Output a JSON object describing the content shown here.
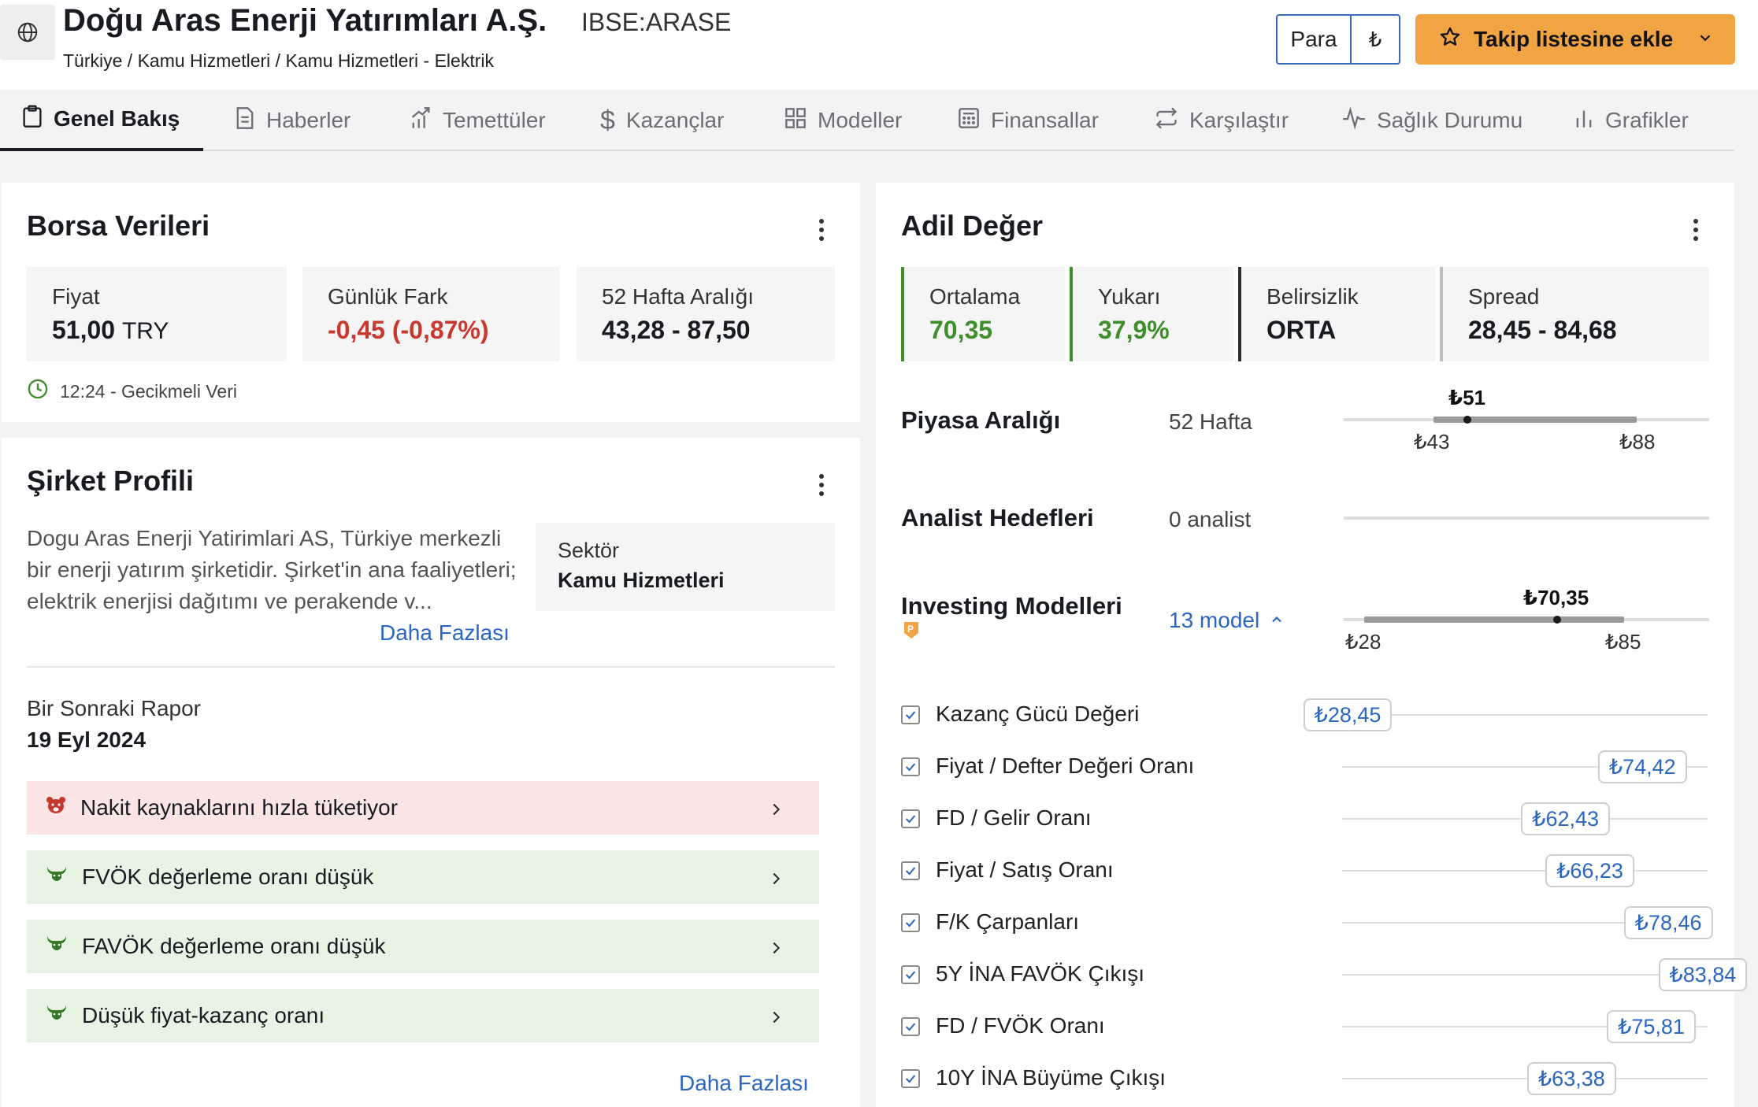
{
  "header": {
    "company_name": "Doğu Aras Enerji Yatırımları A.Ş.",
    "ticker": "IBSE:ARASE",
    "breadcrumb": "Türkiye / Kamu Hizmetleri / Kamu Hizmetleri - Elektrik",
    "currency_label": "Para",
    "currency_symbol": "₺",
    "watchlist_label": "Takip listesine ekle"
  },
  "tabs": [
    {
      "label": "Genel Bakış",
      "icon": "clipboard-icon",
      "active": true
    },
    {
      "label": "Haberler",
      "icon": "document-icon"
    },
    {
      "label": "Temettüler",
      "icon": "growth-chart-icon"
    },
    {
      "label": "Kazançlar",
      "icon": "dollar-icon"
    },
    {
      "label": "Modeller",
      "icon": "grid-icon"
    },
    {
      "label": "Finansallar",
      "icon": "calculator-icon"
    },
    {
      "label": "Karşılaştır",
      "icon": "compare-arrows-icon"
    },
    {
      "label": "Sağlık Durumu",
      "icon": "pulse-icon"
    },
    {
      "label": "Grafikler",
      "icon": "bar-chart-icon"
    }
  ],
  "market_data": {
    "title": "Borsa Verileri",
    "price_label": "Fiyat",
    "price_value": "51,00",
    "price_currency": "TRY",
    "daily_change_label": "Günlük Fark",
    "daily_change_value": "-0,45 (-0,87%)",
    "range_label": "52 Hafta Aralığı",
    "range_value": "43,28 - 87,50",
    "delay_note": "12:24 - Gecikmeli Veri"
  },
  "profile": {
    "title": "Şirket Profili",
    "description_lines": [
      "Dogu Aras Enerji Yatirimlari AS, Türkiye merkezli",
      "bir enerji yatırım şirketidir. Şirket'in ana faaliyetleri;",
      "elektrik enerjisi dağıtımı ve perakende v..."
    ],
    "more_label": "Daha Fazlası",
    "sector_label": "Sektör",
    "sector_value": "Kamu Hizmetleri",
    "next_report_label": "Bir Sonraki Rapor",
    "next_report_date": "19 Eyl 2024",
    "signals": [
      {
        "type": "bear",
        "text": "Nakit kaynaklarını hızla tüketiyor"
      },
      {
        "type": "bull",
        "text": "FVÖK değerleme oranı düşük"
      },
      {
        "type": "bull",
        "text": "FAVÖK değerleme oranı düşük"
      },
      {
        "type": "bull",
        "text": "Düşük fiyat-kazanç oranı"
      }
    ],
    "signals_more_label": "Daha Fazlası"
  },
  "fair_value": {
    "title": "Adil Değer",
    "average_label": "Ortalama",
    "average_value": "70,35",
    "upside_label": "Yukarı",
    "upside_value": "37,9%",
    "uncertainty_label": "Belirsizlik",
    "uncertainty_value": "ORTA",
    "spread_label": "Spread",
    "spread_value": "28,45 - 84,68",
    "market_range": {
      "label": "Piyasa Aralığı",
      "sub": "52 Hafta",
      "current_label": "₺51",
      "low_label": "₺43",
      "high_label": "₺88"
    },
    "analyst": {
      "label": "Analist Hedefleri",
      "sub": "0 analist"
    },
    "investing_models": {
      "label": "Investing Modelleri",
      "count_label": "13 model",
      "current_label": "₺70,35",
      "low_label": "₺28",
      "high_label": "₺85"
    },
    "colors": {
      "positive": "#3e8e2b",
      "negative": "#c8382e",
      "link": "#2a67c3",
      "accent": "#f0a444"
    },
    "models": [
      {
        "name": "Kazanç Gücü Değeri",
        "value_label": "₺28,45",
        "value": 28.45
      },
      {
        "name": "Fiyat / Defter Değeri Oranı",
        "value_label": "₺74,42",
        "value": 74.42
      },
      {
        "name": "FD / Gelir Oranı",
        "value_label": "₺62,43",
        "value": 62.43
      },
      {
        "name": "Fiyat / Satış Oranı",
        "value_label": "₺66,23",
        "value": 66.23
      },
      {
        "name": "F/K Çarpanları",
        "value_label": "₺78,46",
        "value": 78.46
      },
      {
        "name": "5Y İNA FAVÖK Çıkışı",
        "value_label": "₺83,84",
        "value": 83.84
      },
      {
        "name": "FD / FVÖK Oranı",
        "value_label": "₺75,81",
        "value": 75.81
      },
      {
        "name": "10Y İNA Büyüme Çıkışı",
        "value_label": "₺63,38",
        "value": 63.38
      }
    ]
  }
}
